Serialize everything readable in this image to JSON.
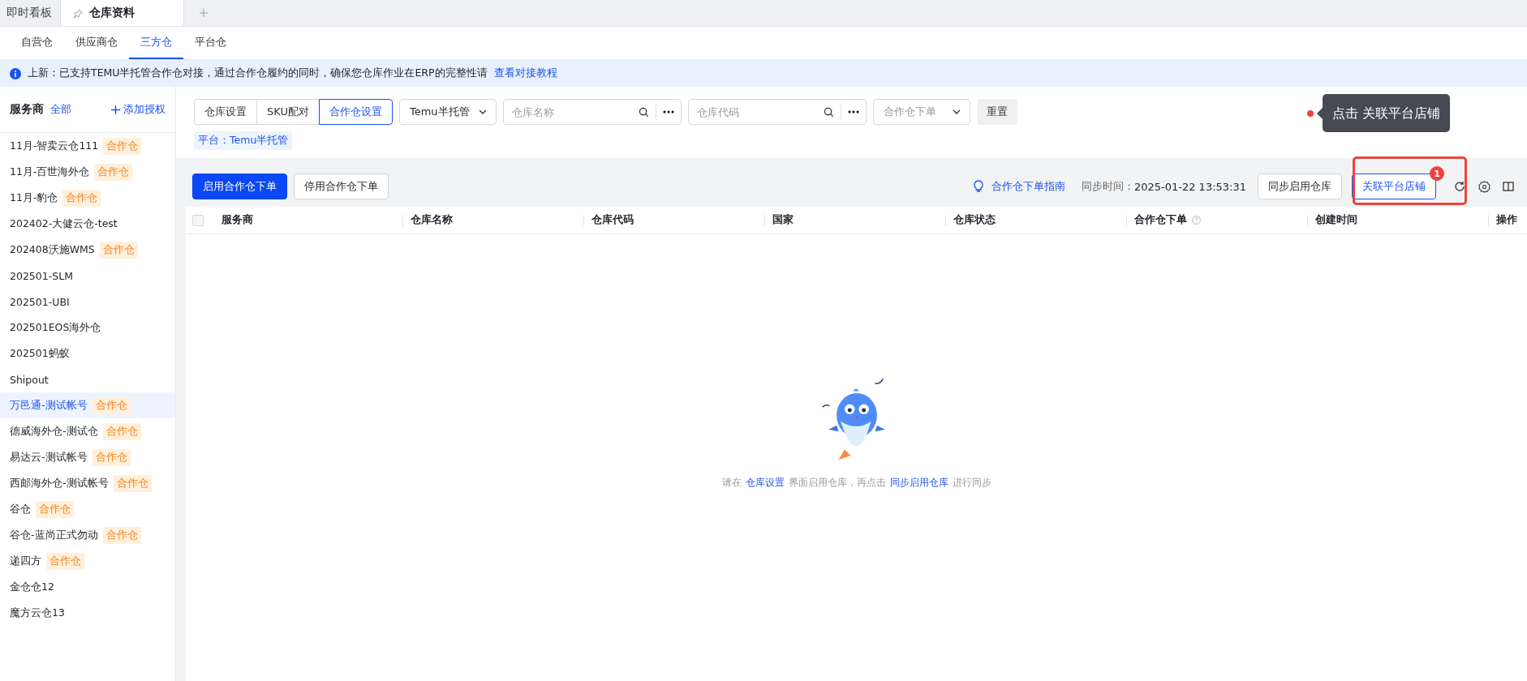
{
  "top_tabs": [
    {
      "label": "即时看板",
      "selected": false,
      "pinned": false
    },
    {
      "label": "仓库资料",
      "selected": true,
      "pinned": true
    }
  ],
  "sub_tabs": [
    {
      "label": "自营仓",
      "selected": false
    },
    {
      "label": "供应商仓",
      "selected": false
    },
    {
      "label": "三方仓",
      "selected": true
    },
    {
      "label": "平台仓",
      "selected": false
    }
  ],
  "notice": {
    "text": "上新：已支持TEMU半托管合作仓对接，通过合作仓履约的同时，确保您仓库作业在ERP的完整性请",
    "link": "查看对接教程"
  },
  "sidebar": {
    "title": "服务商",
    "filter_link": "全部",
    "add_button": "添加授权",
    "items": [
      {
        "name": "11月-智卖云仓111",
        "tag": "合作仓",
        "selected": false
      },
      {
        "name": "11月-百世海外仓",
        "tag": "合作仓",
        "selected": false
      },
      {
        "name": "11月-豹仓",
        "tag": "合作仓",
        "selected": false
      },
      {
        "name": "202402-大健云仓-test",
        "selected": false
      },
      {
        "name": "202408沃施WMS",
        "tag": "合作仓",
        "selected": false
      },
      {
        "name": "202501-SLM",
        "selected": false
      },
      {
        "name": "202501-UBI",
        "selected": false
      },
      {
        "name": "202501EOS海外仓",
        "selected": false
      },
      {
        "name": "202501蚂蚁",
        "selected": false
      },
      {
        "name": "Shipout",
        "selected": false
      },
      {
        "name": "万邑通-测试帐号",
        "tag": "合作仓",
        "selected": true
      },
      {
        "name": "德威海外仓-测试仓",
        "tag": "合作仓",
        "selected": false
      },
      {
        "name": "易达云-测试帐号",
        "tag": "合作仓",
        "selected": false
      },
      {
        "name": "西邮海外仓-测试帐号",
        "tag": "合作仓",
        "selected": false
      },
      {
        "name": "谷仓",
        "tag": "合作仓",
        "selected": false
      },
      {
        "name": "谷仓-蓝尚正式勿动",
        "tag": "合作仓",
        "selected": false
      },
      {
        "name": "递四方",
        "tag": "合作仓",
        "selected": false
      },
      {
        "name": "金仓仓12",
        "selected": false
      },
      {
        "name": "魔方云仓13",
        "selected": false
      }
    ]
  },
  "filters": {
    "segments": [
      {
        "label": "仓库设置",
        "selected": false
      },
      {
        "label": "SKU配对",
        "selected": false
      },
      {
        "label": "合作仓设置",
        "selected": true
      }
    ],
    "platform_select": "Temu半托管",
    "name_search": {
      "placeholder": "仓库名称"
    },
    "code_search": {
      "placeholder": "仓库代码"
    },
    "order_select": {
      "placeholder": "合作仓下单"
    },
    "reset_button": "重置",
    "platform_tag": "平台：Temu半托管"
  },
  "toolbar": {
    "enable_button": "启用合作仓下单",
    "disable_button": "停用合作仓下单",
    "guide_link": "合作仓下单指南",
    "sync_label": "同步时间：",
    "sync_value": "2025-01-22 13:53:31",
    "sync_button": "同步启用仓库",
    "link_button": "关联平台店铺",
    "link_badge": "1"
  },
  "table": {
    "select_all": {
      "checked": false
    },
    "columns": [
      {
        "label": "服务商",
        "help": false
      },
      {
        "label": "仓库名称",
        "help": false
      },
      {
        "label": "仓库代码",
        "help": false
      },
      {
        "label": "国家",
        "help": false
      },
      {
        "label": "仓库状态",
        "help": false
      },
      {
        "label": "合作仓下单",
        "help": true
      },
      {
        "label": "创建时间",
        "help": false
      },
      {
        "label": "操作",
        "help": false
      }
    ]
  },
  "empty_state": {
    "parts": [
      {
        "kind": "text",
        "text": "请在"
      },
      {
        "kind": "link",
        "text": "仓库设置"
      },
      {
        "kind": "text",
        "text": "界面启用仓库，再点击"
      },
      {
        "kind": "link",
        "text": "同步启用仓库"
      },
      {
        "kind": "text",
        "text": "进行同步"
      }
    ]
  },
  "guide": {
    "text": "点击 关联平台店铺"
  }
}
